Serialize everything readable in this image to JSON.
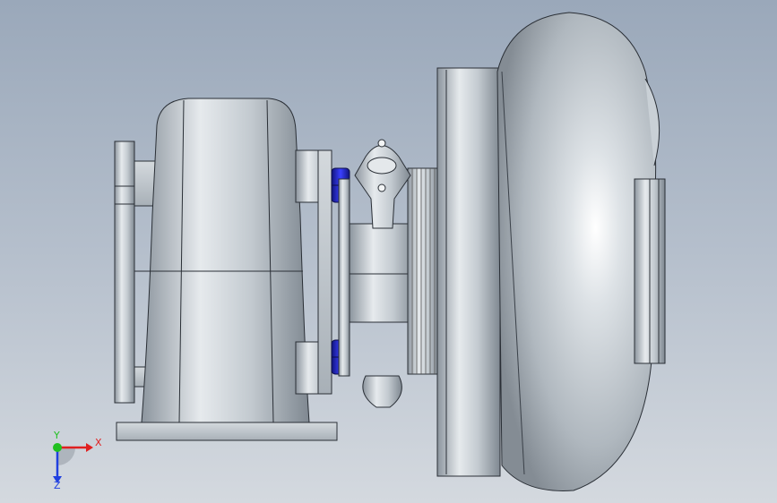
{
  "viewport": {
    "background_top": "#9aa8ba",
    "background_bottom": "#d4d9df"
  },
  "model": {
    "icon": "turbocharger-3d-model",
    "parts": [
      "turbine-housing",
      "turbine-inlet-flange",
      "center-bearing-housing",
      "oil-inlet-flange",
      "compressor-backplate",
      "compressor-housing-volute",
      "compressor-outlet",
      "blue-hex-nuts"
    ],
    "colors": {
      "body": "#c4cbd1",
      "edge": "#2a2f36",
      "fasteners": "#1f24c9"
    }
  },
  "triad": {
    "x_label": "X",
    "y_label": "Y",
    "z_label": "Z",
    "x_color": "#e02020",
    "y_color": "#20c020",
    "z_color": "#2040e0"
  }
}
